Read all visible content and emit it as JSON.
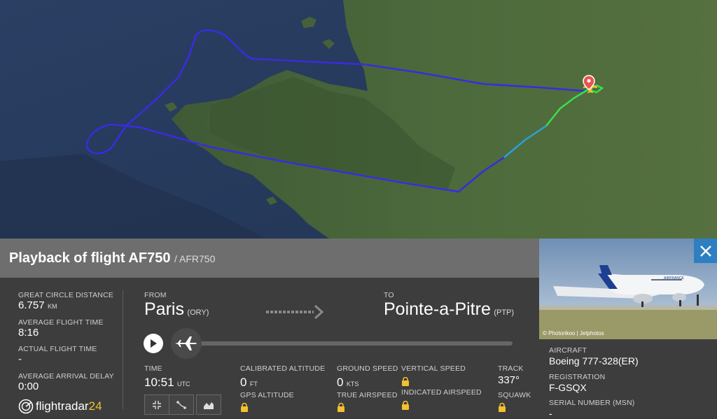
{
  "flight": {
    "title_prefix": "Playback of flight",
    "number": "AF750",
    "callsign": "/ AFR750"
  },
  "stats": {
    "gcd_label": "GREAT CIRCLE DISTANCE",
    "gcd_value": "6.757",
    "gcd_unit": "KM",
    "avg_time_label": "AVERAGE FLIGHT TIME",
    "avg_time_value": "8:16",
    "actual_time_label": "ACTUAL FLIGHT TIME",
    "actual_time_value": "-",
    "avg_delay_label": "AVERAGE ARRIVAL DELAY",
    "avg_delay_value": "0:00"
  },
  "route": {
    "from_label": "FROM",
    "from_city": "Paris",
    "from_code": "(ORY)",
    "to_label": "TO",
    "to_city": "Pointe-a-Pitre",
    "to_code": "(PTP)"
  },
  "playback": {
    "progress": 0
  },
  "telemetry": {
    "time_label": "TIME",
    "time_value": "10:51",
    "time_unit": "UTC",
    "cal_alt_label": "CALIBRATED ALTITUDE",
    "cal_alt_value": "0",
    "cal_alt_unit": "FT",
    "gps_alt_label": "GPS ALTITUDE",
    "ground_speed_label": "GROUND SPEED",
    "ground_speed_value": "0",
    "ground_speed_unit": "KTS",
    "true_airspeed_label": "TRUE AIRSPEED",
    "vertical_speed_label": "VERTICAL SPEED",
    "indicated_airspeed_label": "INDICATED AIRSPEED",
    "track_label": "TRACK",
    "track_value": "337°",
    "squawk_label": "SQUAWK"
  },
  "aircraft": {
    "photo_credit": "© Photorikoo | Jetphotos",
    "aircraft_label": "AIRCRAFT",
    "aircraft_value": "Boeing 777-328(ER)",
    "registration_label": "REGISTRATION",
    "registration_value": "F-GSQX",
    "serial_label": "SERIAL NUMBER (MSN)",
    "serial_value": "-",
    "livery_text": "AIRFRANCE"
  },
  "brand": {
    "logo_text": "flightradar",
    "logo_suffix": "24"
  },
  "colors": {
    "accent_blue": "#2d7fc1",
    "lock_yellow": "#f2c12e",
    "route_purple": "#3a2be0",
    "route_green": "#3ae04a"
  }
}
